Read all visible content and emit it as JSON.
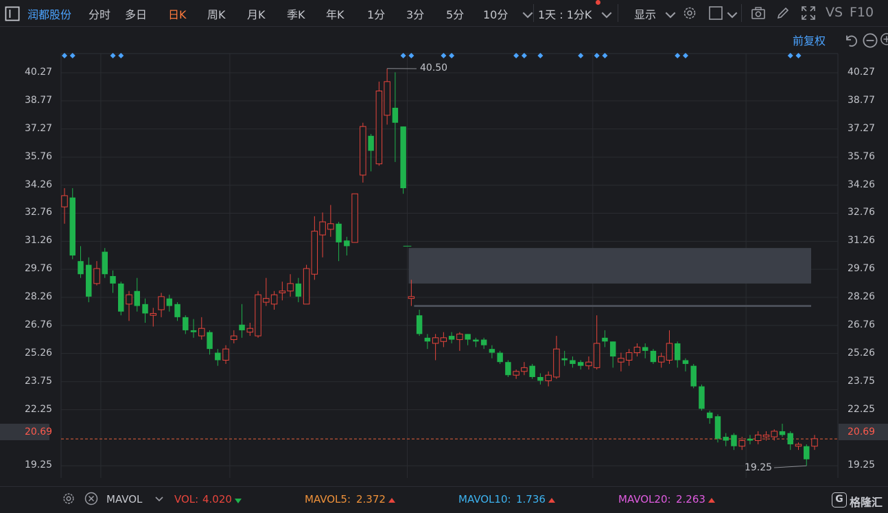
{
  "header": {
    "stock_name": "润都股份",
    "tabs": [
      {
        "label": "分时",
        "active": false
      },
      {
        "label": "多日",
        "active": false
      },
      {
        "label": "日K",
        "active": true
      },
      {
        "label": "周K",
        "active": false
      },
      {
        "label": "月K",
        "active": false
      },
      {
        "label": "季K",
        "active": false
      },
      {
        "label": "年K",
        "active": false
      },
      {
        "label": "1分",
        "active": false
      },
      {
        "label": "3分",
        "active": false
      },
      {
        "label": "5分",
        "active": false
      },
      {
        "label": "10分",
        "active": false
      }
    ],
    "period_select": "1天 : 1分K",
    "display_label": "显示",
    "vs_label": "VS",
    "f10_label": "F10"
  },
  "subheader": {
    "adjust_label": "前复权"
  },
  "colors": {
    "up": "#e8453c",
    "down": "#1fb34d",
    "accent": "#ff7a3d",
    "link": "#4ba3ff",
    "bg": "#1b1c20"
  },
  "chart_data": {
    "type": "candlestick",
    "y_ticks": [
      "40.27",
      "38.77",
      "37.27",
      "35.76",
      "34.26",
      "32.76",
      "31.26",
      "29.76",
      "28.26",
      "26.76",
      "25.26",
      "23.75",
      "22.25",
      "20.69",
      "19.25"
    ],
    "y_tick_values": [
      40.27,
      38.77,
      37.27,
      35.76,
      34.26,
      32.76,
      31.26,
      29.76,
      28.26,
      26.76,
      25.26,
      23.75,
      22.25,
      20.69,
      19.25
    ],
    "ylim": [
      18.6,
      41.3
    ],
    "current_price": "20.69",
    "current_price_value": 20.69,
    "max_label": "40.50",
    "min_label": "19.25",
    "candles": [
      {
        "o": 33.1,
        "c": 33.7,
        "h": 34.1,
        "l": 32.2
      },
      {
        "o": 33.6,
        "c": 30.5,
        "h": 34.1,
        "l": 30.3
      },
      {
        "o": 30.2,
        "c": 29.5,
        "h": 31.0,
        "l": 29.3
      },
      {
        "o": 30.0,
        "c": 28.3,
        "h": 30.4,
        "l": 28.0
      },
      {
        "o": 29.0,
        "c": 29.8,
        "h": 30.2,
        "l": 28.9
      },
      {
        "o": 30.7,
        "c": 29.5,
        "h": 30.9,
        "l": 29.3
      },
      {
        "o": 29.4,
        "c": 29.0,
        "h": 29.7,
        "l": 28.5
      },
      {
        "o": 29.0,
        "c": 27.5,
        "h": 29.1,
        "l": 27.3
      },
      {
        "o": 27.9,
        "c": 28.4,
        "h": 28.6,
        "l": 27.0
      },
      {
        "o": 28.6,
        "c": 27.8,
        "h": 29.3,
        "l": 27.5
      },
      {
        "o": 27.9,
        "c": 27.4,
        "h": 28.2,
        "l": 26.9
      },
      {
        "o": 27.3,
        "c": 27.4,
        "h": 27.7,
        "l": 26.7
      },
      {
        "o": 27.6,
        "c": 28.3,
        "h": 28.5,
        "l": 27.2
      },
      {
        "o": 28.2,
        "c": 27.8,
        "h": 28.4,
        "l": 27.5
      },
      {
        "o": 27.9,
        "c": 27.2,
        "h": 28.0,
        "l": 27.0
      },
      {
        "o": 27.2,
        "c": 26.5,
        "h": 27.3,
        "l": 26.3
      },
      {
        "o": 26.5,
        "c": 26.4,
        "h": 27.1,
        "l": 26.1
      },
      {
        "o": 26.2,
        "c": 26.6,
        "h": 27.2,
        "l": 26.0
      },
      {
        "o": 26.4,
        "c": 25.5,
        "h": 26.5,
        "l": 25.2
      },
      {
        "o": 25.3,
        "c": 24.9,
        "h": 25.5,
        "l": 24.6
      },
      {
        "o": 24.9,
        "c": 25.5,
        "h": 25.7,
        "l": 24.7
      },
      {
        "o": 26.0,
        "c": 26.2,
        "h": 26.5,
        "l": 25.8
      },
      {
        "o": 26.8,
        "c": 26.5,
        "h": 27.9,
        "l": 26.1
      },
      {
        "o": 26.4,
        "c": 26.6,
        "h": 26.9,
        "l": 26.2
      },
      {
        "o": 26.2,
        "c": 28.4,
        "h": 28.6,
        "l": 26.1
      },
      {
        "o": 28.0,
        "c": 28.2,
        "h": 29.3,
        "l": 27.8
      },
      {
        "o": 27.9,
        "c": 28.4,
        "h": 28.6,
        "l": 27.6
      },
      {
        "o": 28.5,
        "c": 28.6,
        "h": 29.1,
        "l": 28.1
      },
      {
        "o": 28.6,
        "c": 29.0,
        "h": 29.5,
        "l": 28.3
      },
      {
        "o": 29.0,
        "c": 28.3,
        "h": 29.3,
        "l": 28.0
      },
      {
        "o": 27.9,
        "c": 29.8,
        "h": 30.0,
        "l": 27.9
      },
      {
        "o": 29.5,
        "c": 31.8,
        "h": 32.6,
        "l": 29.2
      },
      {
        "o": 31.6,
        "c": 32.3,
        "h": 32.8,
        "l": 30.4
      },
      {
        "o": 31.9,
        "c": 32.2,
        "h": 33.2,
        "l": 31.5
      },
      {
        "o": 32.2,
        "c": 31.2,
        "h": 32.3,
        "l": 30.2
      },
      {
        "o": 31.3,
        "c": 31.0,
        "h": 31.5,
        "l": 30.5
      },
      {
        "o": 31.2,
        "c": 33.8,
        "h": 33.8,
        "l": 31.2
      },
      {
        "o": 34.8,
        "c": 37.4,
        "h": 37.6,
        "l": 34.4
      },
      {
        "o": 36.9,
        "c": 36.1,
        "h": 37.0,
        "l": 35.0
      },
      {
        "o": 35.4,
        "c": 39.3,
        "h": 39.8,
        "l": 35.3
      },
      {
        "o": 38.0,
        "c": 39.8,
        "h": 40.5,
        "l": 37.5
      },
      {
        "o": 38.4,
        "c": 37.6,
        "h": 40.3,
        "l": 35.5
      },
      {
        "o": 37.4,
        "c": 34.1,
        "h": 37.4,
        "l": 33.8
      },
      {
        "o": 28.2,
        "c": 28.3,
        "h": 29.2,
        "l": 27.8
      },
      {
        "o": 27.3,
        "c": 26.3,
        "h": 27.6,
        "l": 26.2
      },
      {
        "o": 26.1,
        "c": 25.9,
        "h": 26.3,
        "l": 25.5
      },
      {
        "o": 25.8,
        "c": 26.1,
        "h": 26.3,
        "l": 24.9
      },
      {
        "o": 25.9,
        "c": 26.1,
        "h": 26.4,
        "l": 25.6
      },
      {
        "o": 26.2,
        "c": 26.0,
        "h": 26.4,
        "l": 25.8
      },
      {
        "o": 26.0,
        "c": 26.3,
        "h": 26.4,
        "l": 25.4
      },
      {
        "o": 26.3,
        "c": 26.0,
        "h": 26.3,
        "l": 25.7
      },
      {
        "o": 26.0,
        "c": 25.9,
        "h": 26.1,
        "l": 25.6
      },
      {
        "o": 26.0,
        "c": 25.7,
        "h": 26.1,
        "l": 25.5
      },
      {
        "o": 25.5,
        "c": 25.3,
        "h": 25.7,
        "l": 25.0
      },
      {
        "o": 25.3,
        "c": 24.8,
        "h": 25.4,
        "l": 24.7
      },
      {
        "o": 24.8,
        "c": 24.1,
        "h": 24.9,
        "l": 24.0
      },
      {
        "o": 24.1,
        "c": 24.3,
        "h": 24.4,
        "l": 23.9
      },
      {
        "o": 24.3,
        "c": 24.5,
        "h": 24.8,
        "l": 24.1
      },
      {
        "o": 24.6,
        "c": 24.0,
        "h": 24.7,
        "l": 23.9
      },
      {
        "o": 24.0,
        "c": 23.8,
        "h": 24.2,
        "l": 23.6
      },
      {
        "o": 23.8,
        "c": 24.1,
        "h": 24.3,
        "l": 23.5
      },
      {
        "o": 24.0,
        "c": 25.5,
        "h": 26.2,
        "l": 23.9
      },
      {
        "o": 25.0,
        "c": 24.9,
        "h": 25.4,
        "l": 24.6
      },
      {
        "o": 24.9,
        "c": 24.7,
        "h": 25.1,
        "l": 24.5
      },
      {
        "o": 24.8,
        "c": 24.6,
        "h": 24.9,
        "l": 24.4
      },
      {
        "o": 24.6,
        "c": 24.8,
        "h": 25.1,
        "l": 24.4
      },
      {
        "o": 24.5,
        "c": 25.8,
        "h": 27.3,
        "l": 24.4
      },
      {
        "o": 26.1,
        "c": 25.9,
        "h": 26.5,
        "l": 25.6
      },
      {
        "o": 25.9,
        "c": 25.1,
        "h": 25.9,
        "l": 24.5
      },
      {
        "o": 24.8,
        "c": 25.0,
        "h": 25.3,
        "l": 24.3
      },
      {
        "o": 24.9,
        "c": 25.3,
        "h": 25.5,
        "l": 24.6
      },
      {
        "o": 25.3,
        "c": 25.6,
        "h": 25.8,
        "l": 25.1
      },
      {
        "o": 25.6,
        "c": 25.4,
        "h": 25.8,
        "l": 25.0
      },
      {
        "o": 25.4,
        "c": 24.8,
        "h": 25.5,
        "l": 24.7
      },
      {
        "o": 24.8,
        "c": 25.1,
        "h": 25.3,
        "l": 24.5
      },
      {
        "o": 24.9,
        "c": 25.8,
        "h": 26.5,
        "l": 24.7
      },
      {
        "o": 25.8,
        "c": 24.9,
        "h": 25.9,
        "l": 24.5
      },
      {
        "o": 24.9,
        "c": 24.7,
        "h": 25.0,
        "l": 24.3
      },
      {
        "o": 24.6,
        "c": 23.5,
        "h": 24.7,
        "l": 23.4
      },
      {
        "o": 23.5,
        "c": 22.3,
        "h": 23.6,
        "l": 22.2
      },
      {
        "o": 22.1,
        "c": 21.8,
        "h": 22.2,
        "l": 21.5
      },
      {
        "o": 21.9,
        "c": 20.7,
        "h": 22.0,
        "l": 20.5
      },
      {
        "o": 20.8,
        "c": 20.6,
        "h": 21.0,
        "l": 20.3
      },
      {
        "o": 20.9,
        "c": 20.3,
        "h": 21.0,
        "l": 20.1
      },
      {
        "o": 20.3,
        "c": 20.6,
        "h": 20.8,
        "l": 20.1
      },
      {
        "o": 20.7,
        "c": 20.6,
        "h": 20.9,
        "l": 20.4
      },
      {
        "o": 20.6,
        "c": 20.9,
        "h": 21.1,
        "l": 20.4
      },
      {
        "o": 20.8,
        "c": 20.9,
        "h": 21.1,
        "l": 20.6
      },
      {
        "o": 20.8,
        "c": 21.1,
        "h": 21.2,
        "l": 20.6
      },
      {
        "o": 21.1,
        "c": 20.9,
        "h": 21.5,
        "l": 20.8
      },
      {
        "o": 21.0,
        "c": 20.4,
        "h": 21.1,
        "l": 20.1
      },
      {
        "o": 20.3,
        "c": 20.4,
        "h": 20.5,
        "l": 20.1
      },
      {
        "o": 20.3,
        "c": 19.6,
        "h": 20.4,
        "l": 19.25
      },
      {
        "o": 20.3,
        "c": 20.7,
        "h": 20.9,
        "l": 20.1
      }
    ],
    "gap_zone": {
      "from_price": 29.0,
      "to_price": 30.9
    },
    "gap_line_price": 27.8,
    "marker_diamond_groups": [
      [
        0,
        1
      ],
      [
        6,
        7
      ],
      [
        42,
        43
      ],
      [
        47,
        48
      ],
      [
        56,
        57
      ],
      [
        59
      ],
      [
        64
      ],
      [
        66,
        67
      ],
      [
        76,
        77
      ],
      [
        90,
        91
      ]
    ]
  },
  "volume_bar": {
    "indicator": "MAVOL",
    "vol_label": "VOL:",
    "vol_value": "4.020",
    "mavol5_label": "MAVOL5:",
    "mavol5_value": "2.372",
    "mavol10_label": "MAVOL10:",
    "mavol10_value": "1.736",
    "mavol20_label": "MAVOL20:",
    "mavol20_value": "2.263",
    "colors": {
      "vol": "#e8453c",
      "mavol5": "#f0923a",
      "mavol10": "#3db3f0",
      "mavol20": "#e05ce0"
    }
  },
  "watermark": {
    "text": "格隆汇"
  }
}
